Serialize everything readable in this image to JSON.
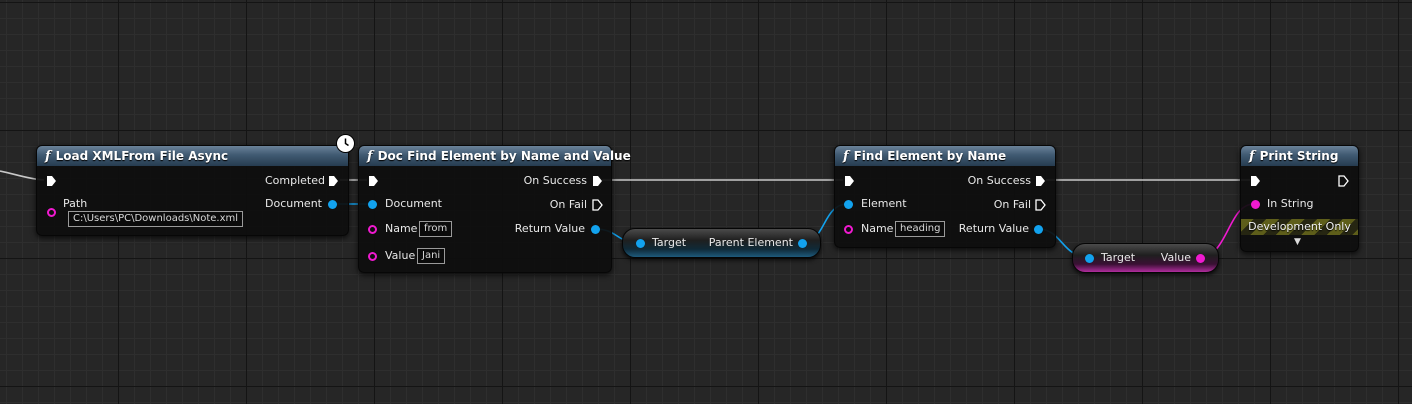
{
  "nodes": {
    "load_xml": {
      "title": "Load XMLFrom File Async",
      "completed_label": "Completed",
      "path_label": "Path",
      "path_value": "C:\\Users\\PC\\Downloads\\Note.xml",
      "document_label": "Document"
    },
    "doc_find": {
      "title": "Doc Find Element by Name and Value",
      "document_label": "Document",
      "name_label": "Name",
      "name_value": "from",
      "value_label": "Value",
      "value_value": "Jani",
      "on_success_label": "On Success",
      "on_fail_label": "On Fail",
      "return_label": "Return Value"
    },
    "parent_element": {
      "target_label": "Target",
      "output_label": "Parent Element"
    },
    "find_element": {
      "title": "Find Element by Name",
      "element_label": "Element",
      "name_label": "Name",
      "name_value": "heading",
      "on_success_label": "On Success",
      "on_fail_label": "On Fail",
      "return_label": "Return Value"
    },
    "value_getter": {
      "target_label": "Target",
      "output_label": "Value"
    },
    "print_string": {
      "title": "Print String",
      "in_string_label": "In String",
      "dev_only_label": "Development Only",
      "expand_glyph": "▼"
    }
  },
  "icons": {
    "function": "f",
    "latent": "clock-icon"
  },
  "colors": {
    "exec_wire": "#c8c8c8",
    "object_pin": "#12a2ee",
    "string_pin": "#f01ad0",
    "header": "#405a72"
  }
}
